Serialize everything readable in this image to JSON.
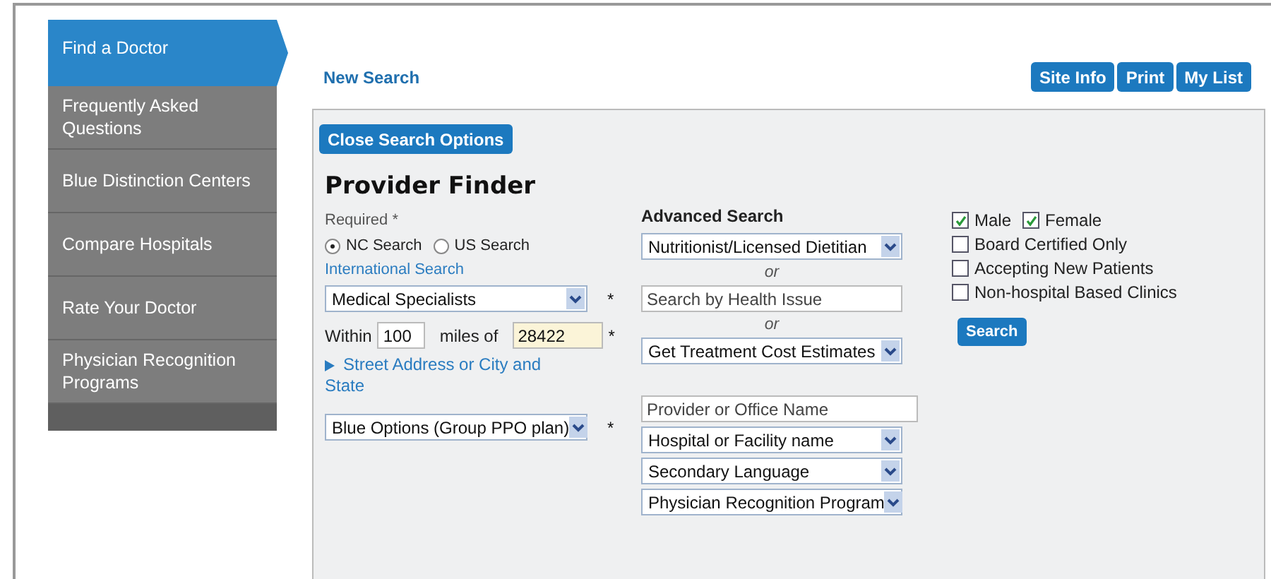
{
  "sidebar": {
    "items": [
      {
        "label": "Find a Doctor",
        "selected": true
      },
      {
        "label": "Frequently Asked Questions",
        "selected": false
      },
      {
        "label": "Blue Distinction Centers",
        "selected": false
      },
      {
        "label": "Compare Hospitals",
        "selected": false
      },
      {
        "label": "Rate Your Doctor",
        "selected": false
      },
      {
        "label": "Physician Recognition Programs",
        "selected": false
      }
    ]
  },
  "header": {
    "link": "New Search",
    "buttons": [
      "Site Info",
      "Print",
      "My List"
    ]
  },
  "panel": {
    "close_button": "Close Search Options",
    "title": "Provider Finder",
    "required_note": "Required *",
    "scope": [
      {
        "label": "NC Search",
        "selected": true
      },
      {
        "label": "US Search",
        "selected": false
      }
    ],
    "international_link": "International Search",
    "specialty": {
      "value": "Medical Specialists",
      "mark": "*"
    },
    "distance": {
      "prefix": "Within",
      "miles": "100",
      "middle": "miles of",
      "zip": "28422",
      "mark": "*"
    },
    "address_link": "Street Address or City and State",
    "plan": {
      "value": "Blue Options (Group PPO plan)",
      "mark": "*"
    },
    "advanced_search": {
      "title": "Advanced Search",
      "fields": [
        {
          "kind": "select",
          "text": "Nutritionist/Licensed Dietitian"
        },
        {
          "kind": "or",
          "text": "or"
        },
        {
          "kind": "input",
          "placeholder": "Search by Health Issue"
        },
        {
          "kind": "or",
          "text": "or"
        },
        {
          "kind": "select",
          "text": "Get Treatment Cost Estimates"
        }
      ],
      "more_fields": [
        {
          "kind": "input",
          "placeholder": "Provider or Office Name"
        },
        {
          "kind": "select",
          "text": "Hospital or Facility name"
        },
        {
          "kind": "select",
          "text": "Secondary Language"
        },
        {
          "kind": "select",
          "text": "Physician Recognition Program"
        }
      ]
    },
    "gender": [
      {
        "label": "Male",
        "checked": true
      },
      {
        "label": "Female",
        "checked": true
      }
    ],
    "filters": [
      {
        "label": "Board Certified Only",
        "checked": false
      },
      {
        "label": "Accepting New Patients",
        "checked": false
      },
      {
        "label": "Non-hospital Based Clinics",
        "checked": false
      }
    ],
    "search_button": "Search"
  }
}
